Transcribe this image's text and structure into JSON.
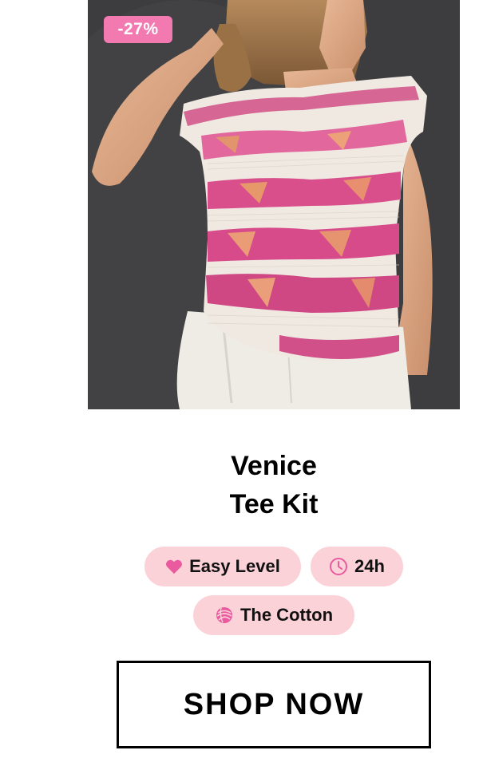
{
  "product": {
    "discount_badge": "-27%",
    "title_line1": "Venice",
    "title_line2": "Tee Kit",
    "image_icon": "product-photo-knitted-tee"
  },
  "tags": {
    "level_label": "Easy Level",
    "level_icon": "heart-icon",
    "time_label": "24h",
    "time_icon": "clock-icon",
    "yarn_label": "The Cotton",
    "yarn_icon": "yarn-ball-icon"
  },
  "cta": {
    "label": "SHOP NOW"
  },
  "colors": {
    "badge": "#f27ab1",
    "pill_background": "#fcd2d9",
    "icon_accent": "#ea5a9e",
    "button_border": "#000000"
  }
}
